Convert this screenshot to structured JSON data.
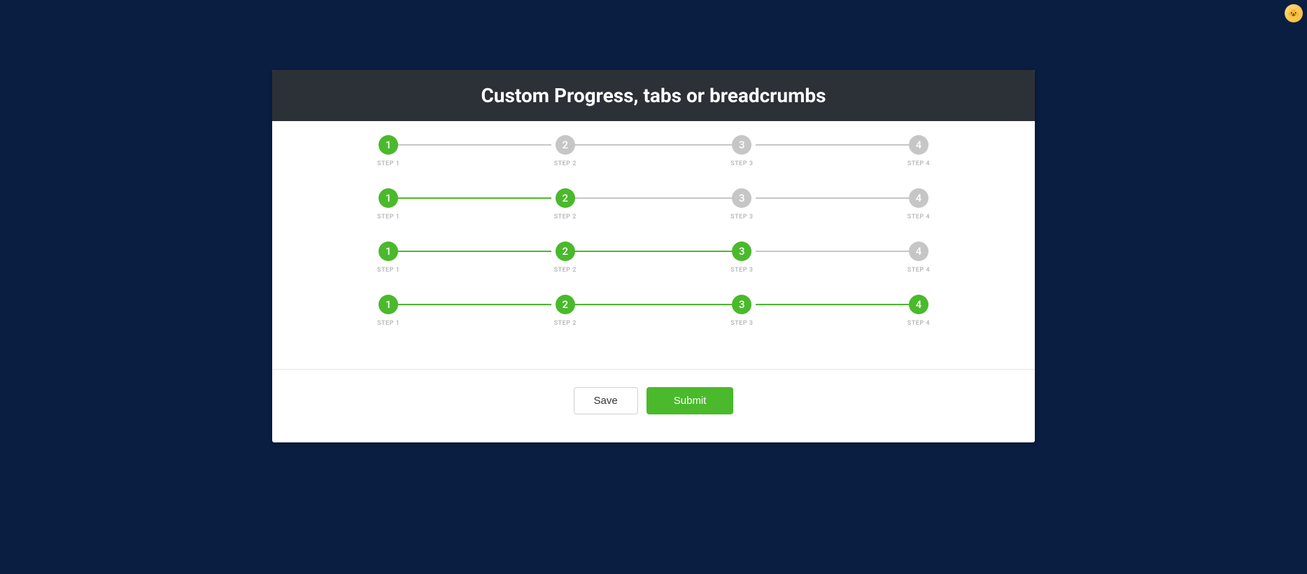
{
  "header_title": "Custom Progress, tabs or breadcrumbs",
  "colors": {
    "active": "#4ab92b",
    "inactive": "#c6c6c6"
  },
  "steps": [
    {
      "num": "1",
      "label": "STEP 1"
    },
    {
      "num": "2",
      "label": "STEP 2"
    },
    {
      "num": "3",
      "label": "STEP 3"
    },
    {
      "num": "4",
      "label": "STEP 4"
    }
  ],
  "rows": [
    {
      "active_to": 1
    },
    {
      "active_to": 2
    },
    {
      "active_to": 3
    },
    {
      "active_to": 4
    }
  ],
  "buttons": {
    "save": "Save",
    "submit": "Submit"
  }
}
